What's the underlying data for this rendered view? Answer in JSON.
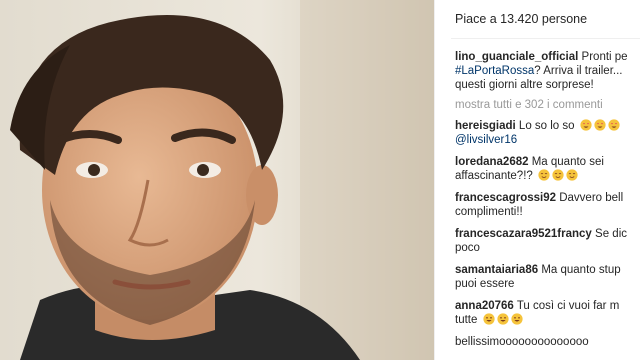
{
  "post": {
    "likes_text": "Piace a 13.420 persone",
    "caption": {
      "username": "lino_guanciale_official",
      "line1": "Pronti pe",
      "hashtag": "#LaPortaRossa",
      "line2_rest": "? Arriva il trailer...",
      "line3": "questi giorni altre sorprese!"
    },
    "view_all_text": "mostra tutti e 302 i commenti"
  },
  "comments": [
    {
      "username": "hereisgiadi",
      "line1": "Lo so lo so",
      "mention": "@livsilver16",
      "emoji": [
        "heart-eyes-emoji",
        "heart-eyes-emoji",
        "heart-eyes-emoji"
      ]
    },
    {
      "username": "loredana2682",
      "line1": "Ma quanto sei",
      "line2": "affascinante?!?",
      "emoji": [
        "blush-emoji",
        "blush-emoji",
        "blush-emoji"
      ]
    },
    {
      "username": "francescagrossi92",
      "line1": "Davvero bell",
      "line2": "complimenti!!"
    },
    {
      "username": "francescazara9521francy",
      "line1": "Se dic",
      "line2": "poco"
    },
    {
      "username": "samantaiaria86",
      "line1": "Ma quanto stup",
      "line2": "puoi essere"
    },
    {
      "username": "anna20766",
      "line1": "Tu così ci vuoi far m",
      "line2": "tutte",
      "emoji": [
        "grin-emoji",
        "grin-emoji",
        "grin-emoji"
      ]
    },
    {
      "username": "",
      "line1": "bellissimoooooooooooooo"
    }
  ],
  "colors": {
    "hashtag": "#003569",
    "muted": "#999999",
    "text": "#262626"
  }
}
